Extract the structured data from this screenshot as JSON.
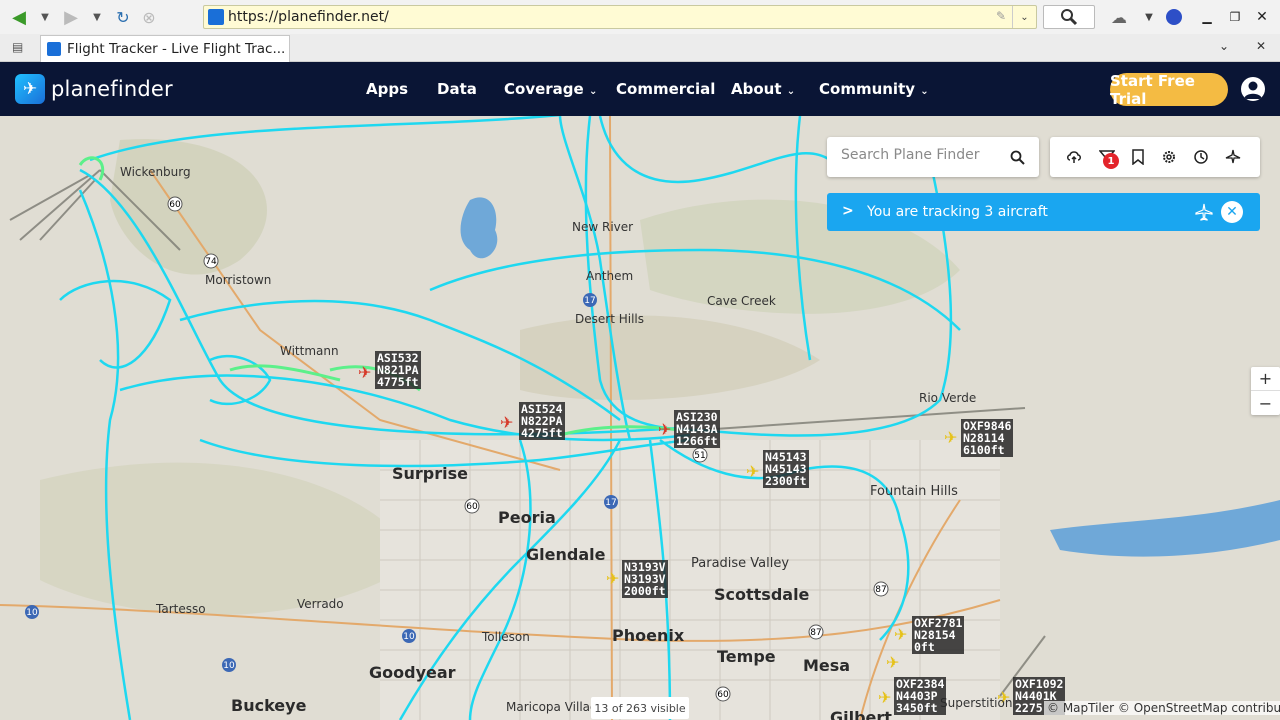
{
  "browser": {
    "url": "https://planefinder.net/",
    "tab_title": "Flight Tracker - Live Flight Trac...",
    "icons": [
      "back-icon",
      "forward-icon",
      "reload-icon",
      "stop-icon",
      "search-icon",
      "addon-icon",
      "close-icon"
    ]
  },
  "site": {
    "logo_text": "planefinder",
    "nav": [
      {
        "label": "Apps"
      },
      {
        "label": "Data"
      },
      {
        "label": "Coverage"
      },
      {
        "label": "Commercial"
      },
      {
        "label": "About"
      },
      {
        "label": "Community"
      }
    ],
    "trial_label": "Start Free Trial"
  },
  "map": {
    "search_placeholder": "Search Plane Finder",
    "alerts_badge": "1",
    "tracking_text": "You are tracking 3 aircraft",
    "visible_count": "13 of 263 visible",
    "attribution": "© MapTiler © OpenStreetMap contributors",
    "zoom_in": "+",
    "zoom_out": "−",
    "places": [
      {
        "name": "Wickenburg"
      },
      {
        "name": "Morristown"
      },
      {
        "name": "New River"
      },
      {
        "name": "Anthem"
      },
      {
        "name": "Cave Creek"
      },
      {
        "name": "Desert Hills"
      },
      {
        "name": "Wittmann"
      },
      {
        "name": "Rio Verde"
      },
      {
        "name": "Fountain Hills"
      },
      {
        "name": "Surprise"
      },
      {
        "name": "Peoria"
      },
      {
        "name": "Glendale"
      },
      {
        "name": "Paradise Valley"
      },
      {
        "name": "Scottsdale"
      },
      {
        "name": "Tartesso"
      },
      {
        "name": "Verrado"
      },
      {
        "name": "Tolleson"
      },
      {
        "name": "Phoenix"
      },
      {
        "name": "Tempe"
      },
      {
        "name": "Mesa"
      },
      {
        "name": "Goodyear"
      },
      {
        "name": "Buckeye"
      },
      {
        "name": "Maricopa Village"
      },
      {
        "name": "Gilbert"
      },
      {
        "name": "Superstition"
      }
    ],
    "aircraft": [
      {
        "lines": [
          "ASI532",
          "N821PA",
          "4775ft"
        ]
      },
      {
        "lines": [
          "ASI524",
          "N822PA",
          "4275ft"
        ]
      },
      {
        "lines": [
          "ASI230",
          "N4143A",
          "1266ft"
        ]
      },
      {
        "lines": [
          "OXF9846",
          "N28114",
          "6100ft"
        ]
      },
      {
        "lines": [
          "N45143",
          "N45143",
          "2300ft"
        ]
      },
      {
        "lines": [
          "N3193V",
          "N3193V",
          "2000ft"
        ]
      },
      {
        "lines": [
          "OXF2781",
          "N28154",
          "0ft"
        ]
      },
      {
        "lines": [
          "OXF2384",
          "N4403P",
          "3450ft"
        ]
      },
      {
        "lines": [
          "OXF1092",
          "N4401K",
          "2275"
        ]
      }
    ],
    "colors": {
      "track": "#1ed8f0",
      "track_green": "#5cf08a",
      "nav_bg": "#0a1535",
      "trial": "#f4bb43",
      "banner": "#1aa6f0"
    }
  }
}
